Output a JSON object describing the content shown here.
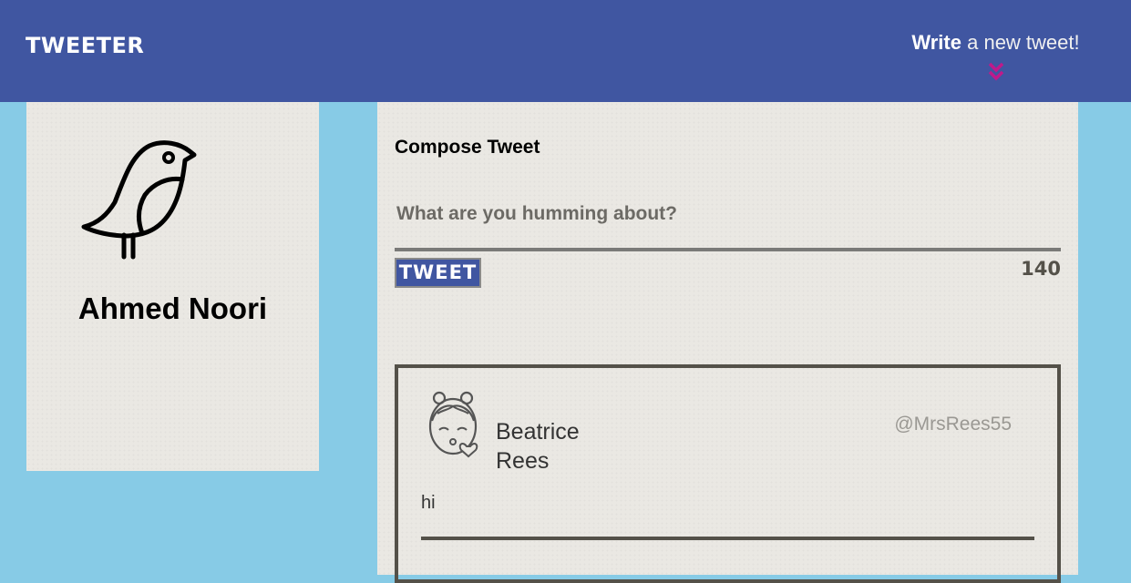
{
  "nav": {
    "brand": "TWEETER",
    "compose_toggle_bold": "Write",
    "compose_toggle_rest": "a new tweet!",
    "chevron_icon": "double-chevron-down-icon",
    "colors": {
      "nav_bg": "#4056a1",
      "chevron": "#c0198b"
    }
  },
  "profile": {
    "avatar_icon": "bird-icon",
    "name": "Ahmed Noori"
  },
  "compose": {
    "title": "Compose Tweet",
    "placeholder": "What are you humming about?",
    "value": "",
    "button_label": "Tweet",
    "counter": "140"
  },
  "tweets": [
    {
      "avatar_icon": "girl-kiss-avatar-icon",
      "name": "Beatrice Rees",
      "handle": "@MrsRees55",
      "content": "hi"
    }
  ],
  "colors": {
    "page_bg": "#87cbe6",
    "panel_bg": "#eae8e3",
    "accent": "#4056a1",
    "border": "#545149"
  }
}
